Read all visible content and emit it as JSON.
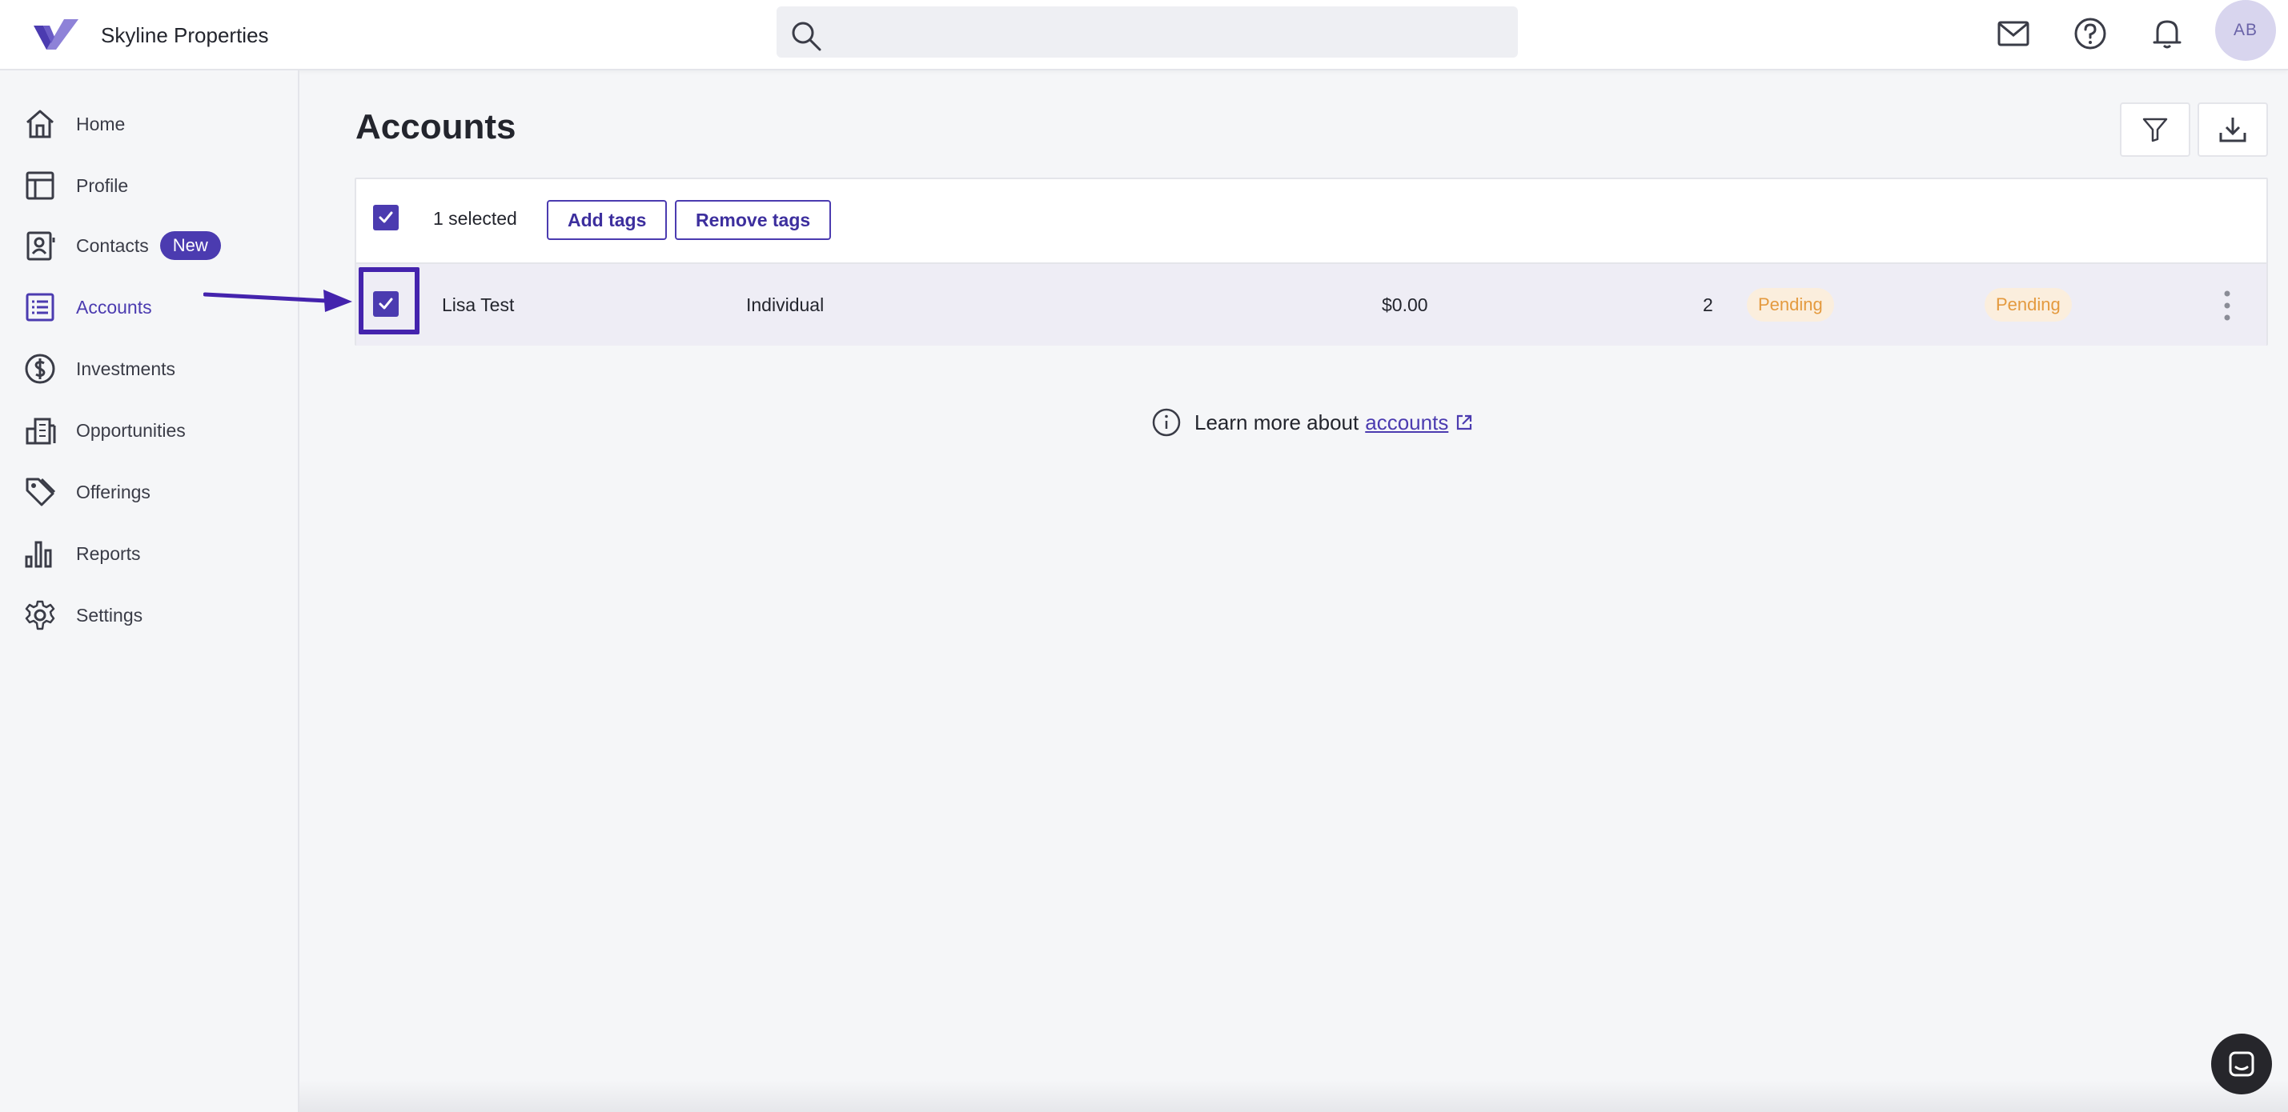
{
  "app": {
    "brand_name": "Skyline Properties",
    "brand_color": "#4b3bb0"
  },
  "search": {
    "placeholder": "",
    "value": ""
  },
  "header": {
    "icons": [
      "mail-icon",
      "help-icon",
      "bell-icon"
    ],
    "avatar_initials": "AB"
  },
  "sidebar": {
    "items": [
      {
        "label": "Home",
        "icon": "home-icon"
      },
      {
        "label": "Profile",
        "icon": "layout-icon"
      },
      {
        "label": "Contacts",
        "icon": "contacts-icon",
        "badge": "New"
      },
      {
        "label": "Accounts",
        "icon": "list-icon",
        "active": true
      },
      {
        "label": "Investments",
        "icon": "dollar-icon"
      },
      {
        "label": "Opportunities",
        "icon": "building-icon"
      },
      {
        "label": "Offerings",
        "icon": "tags-icon"
      },
      {
        "label": "Reports",
        "icon": "bar-chart-icon"
      },
      {
        "label": "Settings",
        "icon": "gear-icon"
      }
    ]
  },
  "main": {
    "title": "Accounts",
    "toolbar": [
      "filter-icon",
      "download-icon"
    ],
    "bulk": {
      "selected_text": "1 selected",
      "add_tags": "Add tags",
      "remove_tags": "Remove tags"
    },
    "rows": [
      {
        "name": "Lisa Test",
        "type": "Individual",
        "amount": "$0.00",
        "count": "2",
        "status_1": "Pending",
        "status_2": "Pending",
        "checked": true
      }
    ],
    "learn_more": {
      "text": "Learn more about",
      "link": "accounts"
    }
  },
  "colors": {
    "accent": "#4b3bb0",
    "pending_bg": "#fbeedd",
    "pending_text": "#e49a3f",
    "selected_row_bg": "#eeedf5"
  }
}
